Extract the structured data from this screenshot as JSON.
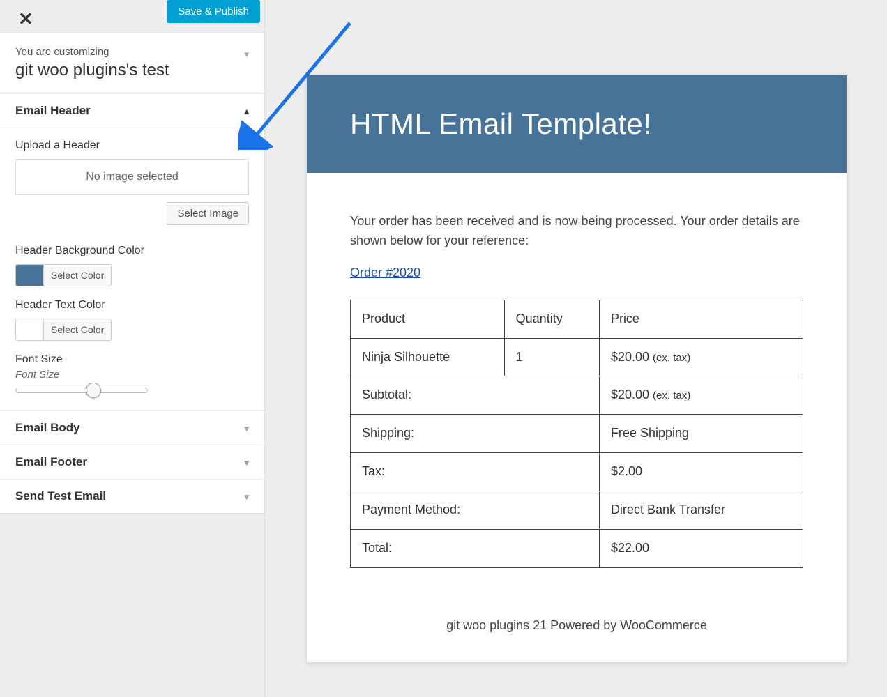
{
  "topbar": {
    "save_label": "Save & Publish"
  },
  "context": {
    "label": "You are customizing",
    "title": "git woo plugins's test"
  },
  "sections": {
    "email_header": {
      "title": "Email Header",
      "upload_label": "Upload a Header",
      "no_image_text": "No image selected",
      "select_image_label": "Select Image",
      "bg_label": "Header Background Color",
      "bg_color": "#467397",
      "select_color_label": "Select Color",
      "text_color_label": "Header Text Color",
      "text_color": "#ffffff",
      "font_size_label": "Font Size",
      "font_size_hint": "Font Size"
    },
    "email_body": {
      "title": "Email Body"
    },
    "email_footer": {
      "title": "Email Footer"
    },
    "send_test": {
      "title": "Send Test Email"
    }
  },
  "email": {
    "header_title": "HTML Email Template!",
    "intro": "Your order has been received and is now being processed. Your order details are shown below for your reference:",
    "order_link": "Order #2020",
    "columns": {
      "product": "Product",
      "quantity": "Quantity",
      "price": "Price"
    },
    "items": [
      {
        "product": "Ninja Silhouette",
        "quantity": "1",
        "price": "$20.00",
        "price_note": "(ex. tax)"
      }
    ],
    "summary": {
      "subtotal_label": "Subtotal:",
      "subtotal_value": "$20.00",
      "subtotal_note": "(ex. tax)",
      "shipping_label": "Shipping:",
      "shipping_value": "Free Shipping",
      "tax_label": "Tax:",
      "tax_value": "$2.00",
      "payment_label": "Payment Method:",
      "payment_value": "Direct Bank Transfer",
      "total_label": "Total:",
      "total_value": "$22.00"
    },
    "footer": "git woo plugins 21 Powered by WooCommerce"
  }
}
